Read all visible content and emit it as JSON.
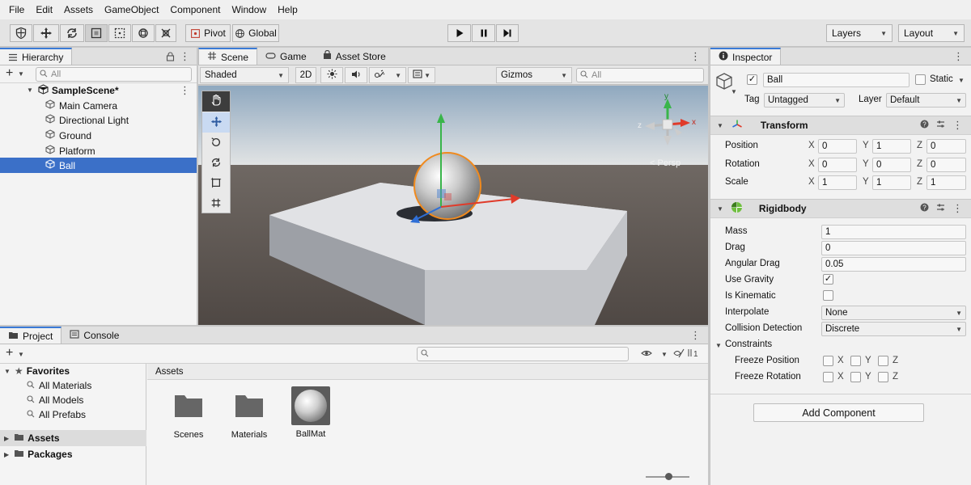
{
  "menu": [
    "File",
    "Edit",
    "Assets",
    "GameObject",
    "Component",
    "Window",
    "Help"
  ],
  "toolbar": {
    "pivot": "Pivot",
    "global": "Global",
    "layers": "Layers",
    "layout": "Layout"
  },
  "hierarchy": {
    "tab": "Hierarchy",
    "search_placeholder": "All",
    "scene": "SampleScene*",
    "objects": [
      "Main Camera",
      "Directional Light",
      "Ground",
      "Platform",
      "Ball"
    ],
    "selected": "Ball"
  },
  "scene_tabs": {
    "scene": "Scene",
    "game": "Game",
    "asset_store": "Asset Store"
  },
  "scene_bar": {
    "shading": "Shaded",
    "mode_2d": "2D",
    "gizmos": "Gizmos",
    "search_placeholder": "All"
  },
  "scene_view": {
    "persp_label": "< Persp",
    "gizmo_axes": {
      "x": "x",
      "y": "y",
      "z": "z"
    }
  },
  "inspector": {
    "tab": "Inspector",
    "object_name": "Ball",
    "static_label": "Static",
    "tag_label": "Tag",
    "tag_value": "Untagged",
    "layer_label": "Layer",
    "layer_value": "Default",
    "transform": {
      "title": "Transform",
      "position_label": "Position",
      "position": {
        "x": "0",
        "y": "1",
        "z": "0"
      },
      "rotation_label": "Rotation",
      "rotation": {
        "x": "0",
        "y": "0",
        "z": "0"
      },
      "scale_label": "Scale",
      "scale": {
        "x": "1",
        "y": "1",
        "z": "1"
      }
    },
    "rigidbody": {
      "title": "Rigidbody",
      "mass_label": "Mass",
      "mass": "1",
      "drag_label": "Drag",
      "drag": "0",
      "angular_drag_label": "Angular Drag",
      "angular_drag": "0.05",
      "use_gravity_label": "Use Gravity",
      "use_gravity": true,
      "is_kinematic_label": "Is Kinematic",
      "is_kinematic": false,
      "interpolate_label": "Interpolate",
      "interpolate": "None",
      "collision_label": "Collision Detection",
      "collision": "Discrete",
      "constraints_label": "Constraints",
      "freeze_position_label": "Freeze Position",
      "freeze_rotation_label": "Freeze Rotation"
    },
    "axis": {
      "x": "X",
      "y": "Y",
      "z": "Z"
    },
    "add_component": "Add Component"
  },
  "project": {
    "tab_project": "Project",
    "tab_console": "Console",
    "favorites": "Favorites",
    "favorites_items": [
      "All Materials",
      "All Models",
      "All Prefabs"
    ],
    "assets_root": "Assets",
    "packages_root": "Packages",
    "breadcrumb": "Assets",
    "items": [
      "Scenes",
      "Materials",
      "BallMat"
    ],
    "hidden_count": "1"
  }
}
